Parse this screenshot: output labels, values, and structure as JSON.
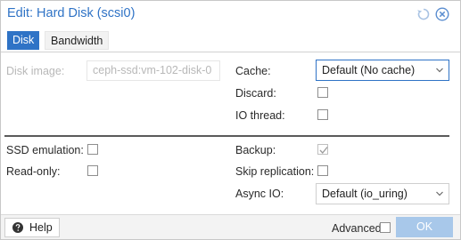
{
  "dialog": {
    "title": "Edit: Hard Disk (scsi0)",
    "accent_color": "#2f73c6"
  },
  "toolbar": {
    "reset_icon": "reset-icon",
    "close_icon": "close-icon"
  },
  "tabs": [
    {
      "label": "Disk",
      "active": true
    },
    {
      "label": "Bandwidth",
      "active": false
    }
  ],
  "form": {
    "disk_image": {
      "label": "Disk image:",
      "value": "ceph-ssd:vm-102-disk-0",
      "disabled": true
    },
    "cache": {
      "label": "Cache:",
      "value": "Default (No cache)"
    },
    "discard": {
      "label": "Discard:",
      "checked": false
    },
    "io_thread": {
      "label": "IO thread:",
      "checked": false
    },
    "ssd_emulation": {
      "label": "SSD emulation:",
      "checked": false
    },
    "read_only": {
      "label": "Read-only:",
      "checked": false
    },
    "backup": {
      "label": "Backup:",
      "checked": true,
      "disabled": true
    },
    "skip_replication": {
      "label": "Skip replication:",
      "checked": false
    },
    "async_io": {
      "label": "Async IO:",
      "value": "Default (io_uring)"
    }
  },
  "footer": {
    "help_label": "Help",
    "advanced_label": "Advanced",
    "advanced_checked": false,
    "ok_label": "OK",
    "ok_disabled": true
  }
}
